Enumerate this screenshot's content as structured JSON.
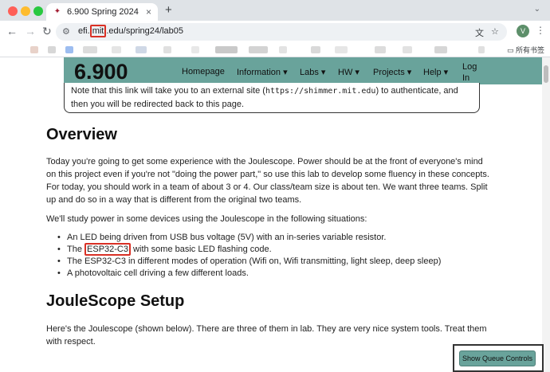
{
  "browser": {
    "tab": {
      "title": "6.900 Spring 2024",
      "close": "×",
      "favicon": "✦"
    },
    "new_tab": "+",
    "tab_menu": "⌄",
    "nav": {
      "back": "←",
      "forward": "→",
      "reload": "↻"
    },
    "address": {
      "url_prefix": "efi.",
      "url_highlight": "mit",
      "url_suffix": ".edu/spring24/lab05",
      "site_info": "⚙"
    },
    "translate_icon": "文",
    "star_icon": "☆",
    "profile_initial": "V",
    "menu_icon": "⋮",
    "bookmarks_all": "所有书签"
  },
  "site": {
    "brand": "6.900",
    "nav": [
      {
        "label": "Homepage"
      },
      {
        "label": "Information ▾"
      },
      {
        "label": "Labs ▾"
      },
      {
        "label": "HW ▾"
      },
      {
        "label": "Projects ▾"
      },
      {
        "label": "Help ▾"
      }
    ],
    "login": "Log In"
  },
  "content": {
    "note_pre": "Note that this link will take you to an external site (",
    "note_code": "https://shimmer.mit.edu",
    "note_post": ") to authenticate, and then you will be redirected back to this page.",
    "h_overview": "Overview",
    "p1": "Today you're going to get some experience with the Joulescope. Power should be at the front of everyone's mind on this project even if you're not \"doing the power part,\" so use this lab to develop some fluency in these concepts. For today, you should work in a team of about 3 or 4. Our class/team size is about ten. We want three teams. Split up and do so in a way that is different from the original two teams.",
    "p2": "We'll study power in some devices using the Joulescope in the following situations:",
    "list": {
      "item1": "An LED being driven from USB bus voltage (5V) with an in-series variable resistor.",
      "item2_pre": "The ",
      "item2_hl": "ESP32-C3",
      "item2_post": " with some basic LED flashing code.",
      "item3": "The ESP32-C3 in different modes of operation (Wifi on, Wifi transmitting, light sleep, deep sleep)",
      "item4": "A photovoltaic cell driving a few different loads."
    },
    "h_setup": "JouleScope Setup",
    "p3": "Here's the Joulescope (shown below). There are three of them in lab. They are very nice system tools. Treat them with respect."
  },
  "queue_button": "Show Queue Controls",
  "colors": {
    "nav_bg": "#69a39b",
    "highlight": "#d93025"
  }
}
